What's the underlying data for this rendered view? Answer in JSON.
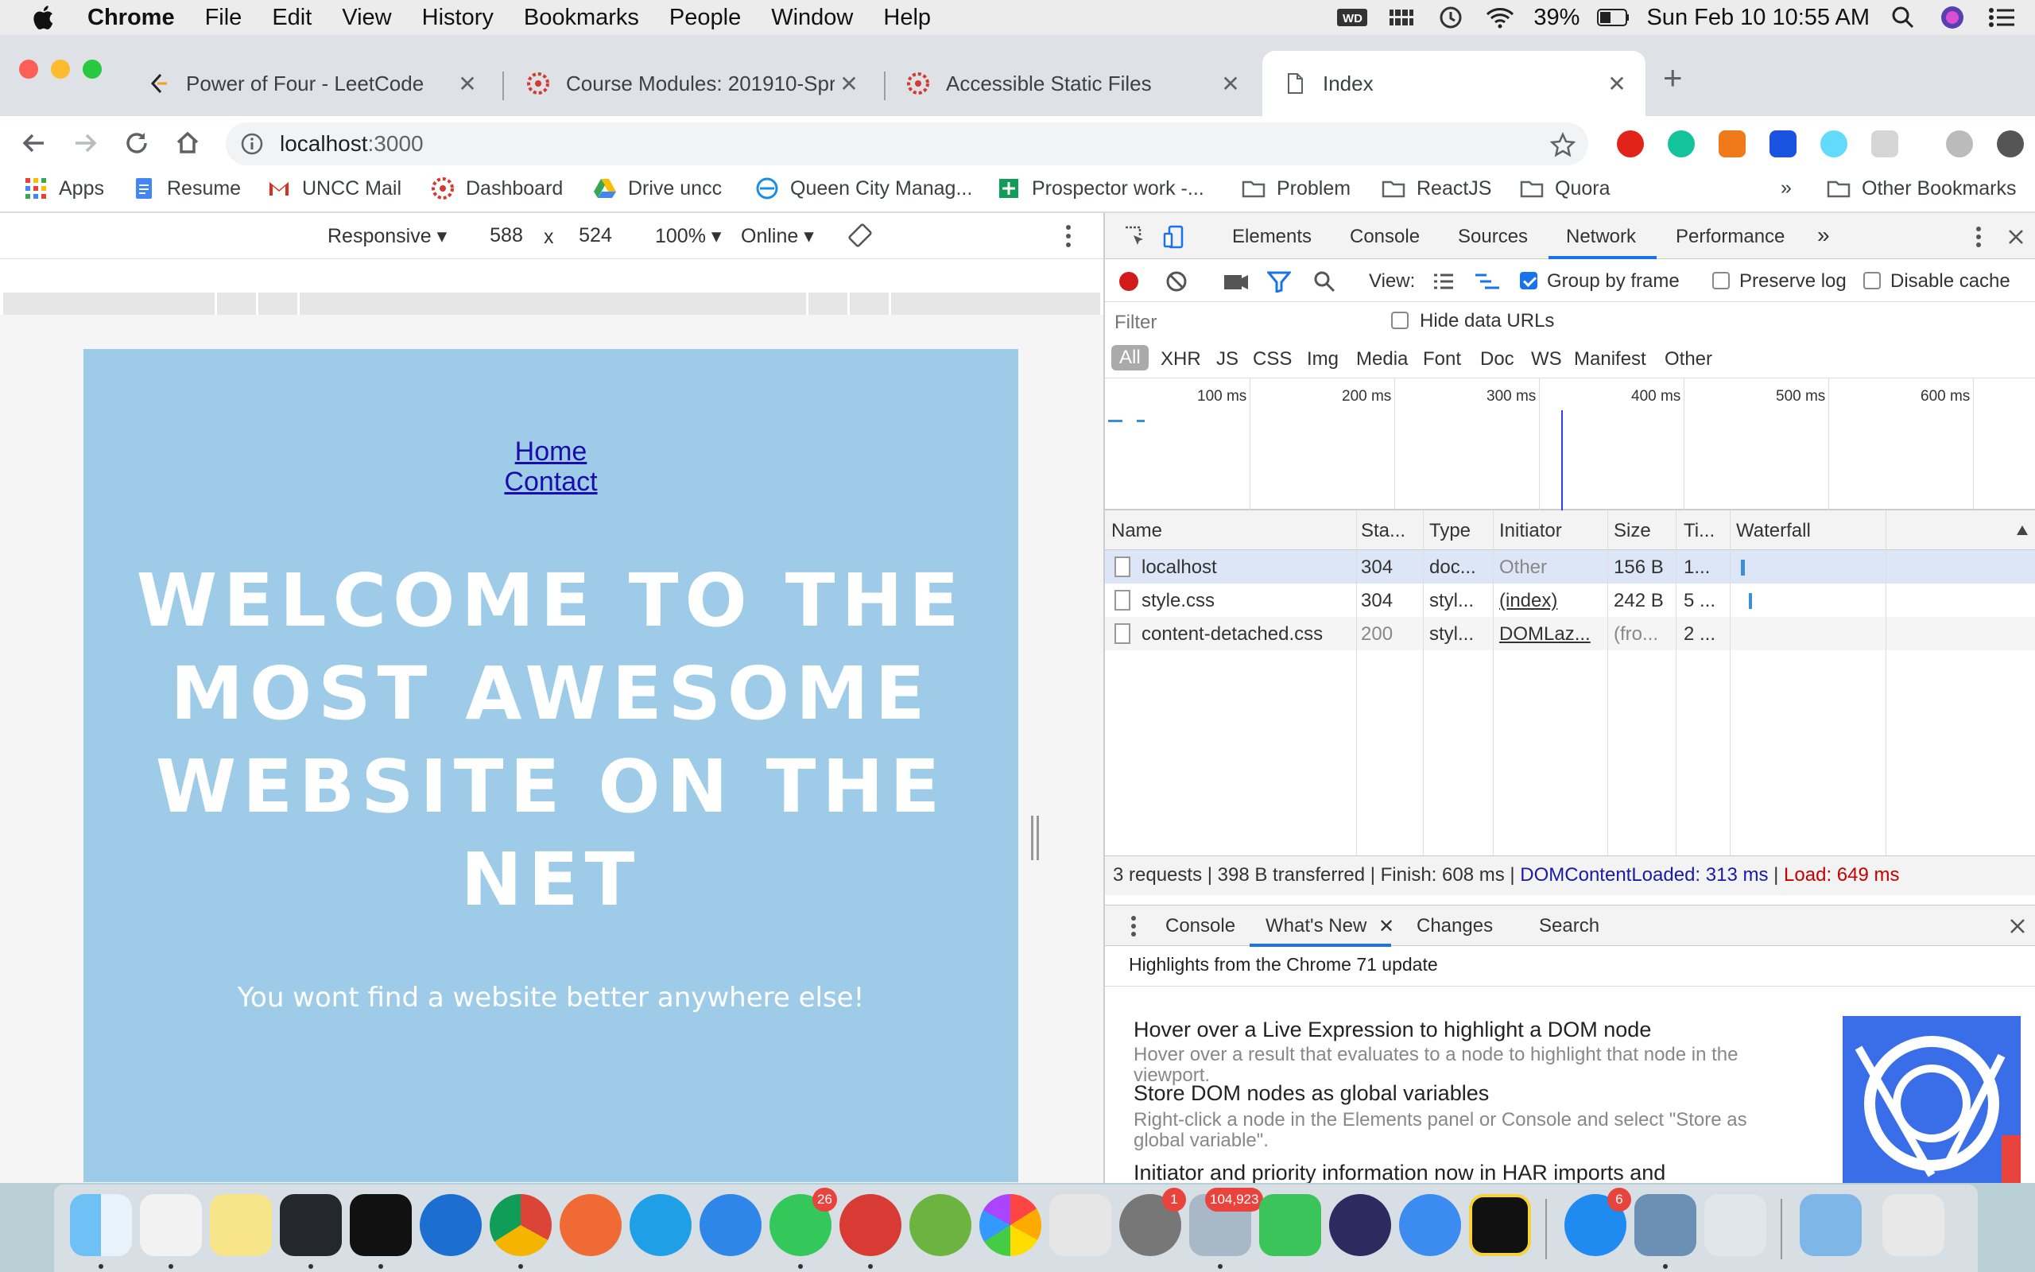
{
  "menubar": {
    "app_name": "Chrome",
    "items": [
      "File",
      "Edit",
      "View",
      "History",
      "Bookmarks",
      "People",
      "Window",
      "Help"
    ],
    "battery": "39%",
    "datetime": "Sun Feb 10  10:55 AM"
  },
  "tabs": [
    {
      "title": "Power of Four - LeetCode",
      "close": "✕"
    },
    {
      "title": "Course Modules: 201910-Sprin",
      "close": "✕"
    },
    {
      "title": "Accessible Static Files",
      "close": "✕"
    },
    {
      "title": "Index",
      "close": "✕",
      "active": true
    }
  ],
  "new_tab": "+",
  "address": {
    "host": "localhost",
    "port": ":3000"
  },
  "bookmarks": [
    "Apps",
    "Resume",
    "UNCC Mail",
    "Dashboard",
    "Drive uncc",
    "Queen City Manag...",
    "Prospector work -...",
    "Problem",
    "ReactJS",
    "Quora"
  ],
  "bookmarks_more": "»",
  "other_bookmarks": "Other Bookmarks",
  "device_toolbar": {
    "device": "Responsive ▾",
    "width": "588",
    "times": "x",
    "height": "524",
    "zoom": "100% ▾",
    "network": "Online ▾"
  },
  "page": {
    "nav": [
      "Home",
      "Contact"
    ],
    "hero": "WELCOME TO THE MOST AWESOME WEBSITE ON THE NET",
    "tagline": "You wont find a website better anywhere else!"
  },
  "devtools": {
    "tabs": [
      "Elements",
      "Console",
      "Sources",
      "Network",
      "Performance"
    ],
    "more_tabs": "»",
    "view_label": "View:",
    "group_by_frame": "Group by frame",
    "preserve_log": "Preserve log",
    "disable_cache": "Disable cache",
    "filter_placeholder": "Filter",
    "hide_data_urls": "Hide data URLs",
    "types": [
      "All",
      "XHR",
      "JS",
      "CSS",
      "Img",
      "Media",
      "Font",
      "Doc",
      "WS",
      "Manifest",
      "Other"
    ],
    "timeline_ticks": [
      "100 ms",
      "200 ms",
      "300 ms",
      "400 ms",
      "500 ms",
      "600 ms"
    ],
    "columns": [
      "Name",
      "Sta...",
      "Type",
      "Initiator",
      "Size",
      "Ti...",
      "Waterfall"
    ],
    "rows": [
      {
        "name": "localhost",
        "status": "304",
        "type": "doc...",
        "initiator": "Other",
        "size": "156 B",
        "time": "1..."
      },
      {
        "name": "style.css",
        "status": "304",
        "type": "styl...",
        "initiator": "(index)",
        "size": "242 B",
        "time": "5 ..."
      },
      {
        "name": "content-detached.css",
        "status": "200",
        "type": "styl...",
        "initiator": "DOMLaz...",
        "size": "(fro...",
        "time": "2 ..."
      }
    ],
    "summary_main": "3 requests | 398 B transferred | Finish: 608 ms | ",
    "summary_dom": "DOMContentLoaded: 313 ms",
    "summary_sep": " | ",
    "summary_load": "Load: 649 ms",
    "drawer_tabs": [
      "Console",
      "What's New",
      "Changes",
      "Search"
    ],
    "drawer_tab_close": "✕",
    "highlights": "Highlights from the Chrome 71 update",
    "whats_new": [
      {
        "title": "Hover over a Live Expression to highlight a DOM node",
        "desc": "Hover over a result that evaluates to a node to highlight that node in the viewport."
      },
      {
        "title": "Store DOM nodes as global variables",
        "desc": "Right-click a node in the Elements panel or Console and select \"Store as global variable\"."
      },
      {
        "title": "Initiator and priority information now in HAR imports and",
        "desc": ""
      }
    ]
  },
  "dock": {
    "badges": [
      "26",
      "1",
      "104,923",
      "6"
    ]
  }
}
